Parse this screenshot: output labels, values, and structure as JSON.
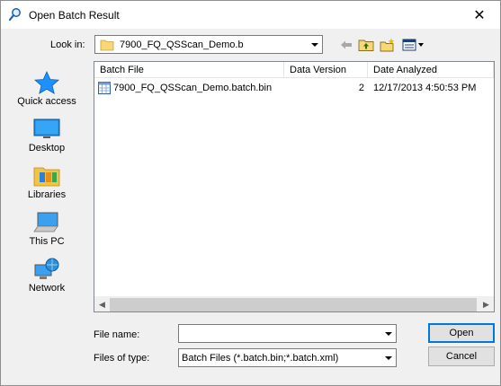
{
  "window": {
    "title": "Open Batch Result"
  },
  "look_in": {
    "label": "Look in:",
    "value": "7900_FQ_QSScan_Demo.b"
  },
  "places": [
    {
      "label": "Quick access",
      "icon": "quick-access-star-icon"
    },
    {
      "label": "Desktop",
      "icon": "desktop-icon"
    },
    {
      "label": "Libraries",
      "icon": "libraries-icon"
    },
    {
      "label": "This PC",
      "icon": "this-pc-icon"
    },
    {
      "label": "Network",
      "icon": "network-icon"
    }
  ],
  "columns": [
    "Batch File",
    "Data Version",
    "Date Analyzed"
  ],
  "files": [
    {
      "name": "7900_FQ_QSScan_Demo.batch.bin",
      "version": "2",
      "date": "12/17/2013 4:50:53 PM",
      "icon": "batch-file-icon"
    }
  ],
  "file_name": {
    "label": "File name:",
    "value": ""
  },
  "file_type": {
    "label": "Files of type:",
    "value": "Batch Files (*.batch.bin;*.batch.xml)"
  },
  "buttons": {
    "open": "Open",
    "cancel": "Cancel"
  },
  "colors": {
    "accent": "#0078d7",
    "folder": "#f8d775",
    "star": "#1e90ff"
  }
}
